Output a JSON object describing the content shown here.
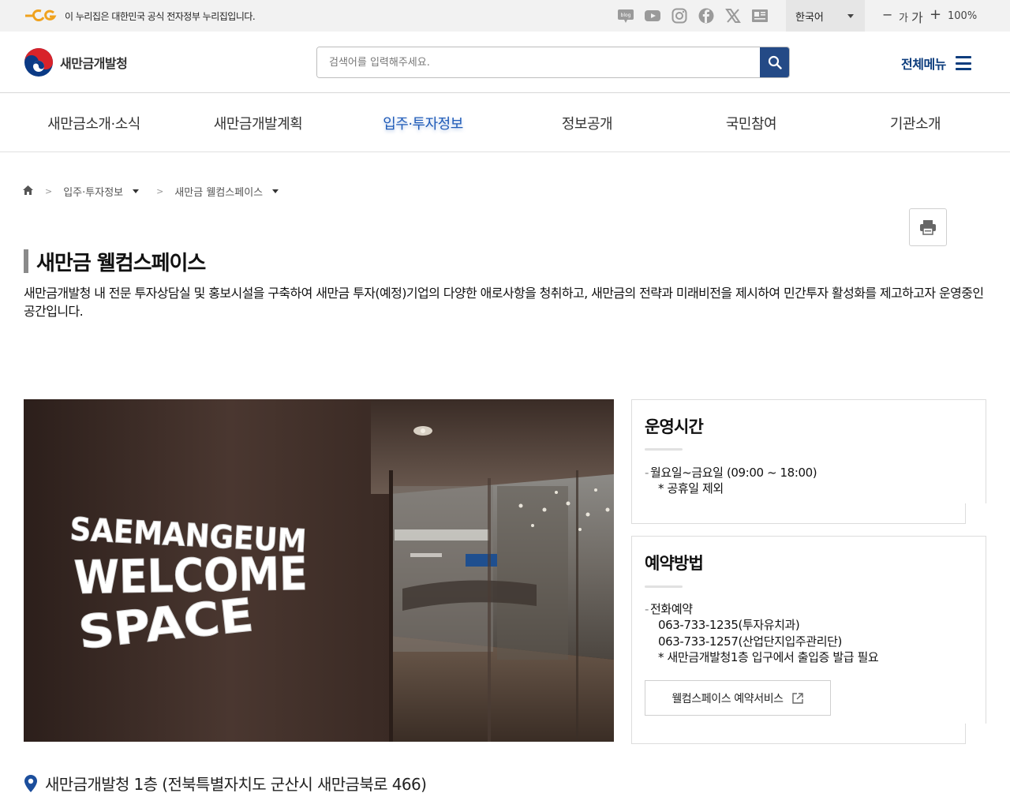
{
  "topbar": {
    "notice": "이 누리집은 대한민국 공식 전자정부 누리집입니다.",
    "social_icons": [
      "blog-icon",
      "youtube-icon",
      "instagram-icon",
      "facebook-icon",
      "x-icon",
      "news-icon"
    ],
    "language": "한국어",
    "font_decrease": "−",
    "font_small": "가",
    "font_large": "가",
    "font_increase": "+",
    "zoom": "100%"
  },
  "header": {
    "logo_text": "새만금개발청",
    "search_placeholder": "검색어를 입력해주세요.",
    "all_menu": "전체메뉴"
  },
  "nav": {
    "items": [
      {
        "label": "새만금소개·소식"
      },
      {
        "label": "새만금개발계획"
      },
      {
        "label": "입주·투자정보",
        "active": true
      },
      {
        "label": "정보공개"
      },
      {
        "label": "국민참여"
      },
      {
        "label": "기관소개"
      }
    ]
  },
  "breadcrumb": {
    "items": [
      "입주·투자정보",
      "새만금 웰컴스페이스"
    ],
    "separator": ">"
  },
  "page": {
    "title": "새만금 웰컴스페이스",
    "description": "새만금개발청 내 전문 투자상담실 및 홍보시설을 구축하여 새만금 투자(예정)기업의 다양한 애로사항을 청취하고, 새만금의 전략과 미래비전을 제시하여 민간투자 활성화를 제고하고자 운영중인 공간입니다."
  },
  "photo": {
    "sign_lines": [
      "SAEMANGEUM",
      "WELCOME",
      "SPACE"
    ]
  },
  "hours_card": {
    "title": "운영시간",
    "dash": "-",
    "line": "월요일~금요일 (09:00 ~ 18:00)",
    "note": "* 공휴일 제외"
  },
  "reserve_card": {
    "title": "예약방법",
    "dash": "-",
    "line": "전화예약",
    "phone1": "063-733-1235(투자유치과)",
    "phone2": "063-733-1257(산업단지입주관리단)",
    "note": "* 새만금개발청1층 입구에서 출입증 발급 필요",
    "button": "웰컴스페이스 예약서비스"
  },
  "address": {
    "text": "새만금개발청 1층 (전북특별자치도 군산시 새만금북로 466)"
  },
  "colors": {
    "accent": "#244a86",
    "nav_active": "#1f5bb8",
    "menu_text": "#0d3d7d"
  }
}
